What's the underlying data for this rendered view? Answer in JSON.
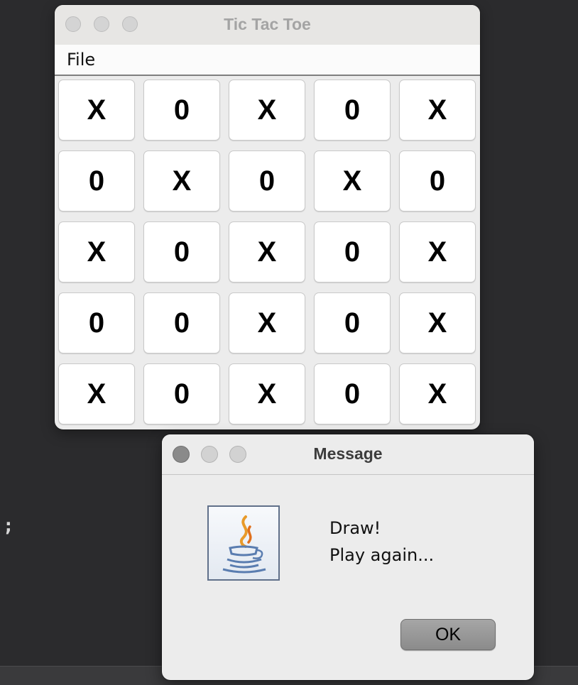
{
  "background": {
    "code_fragment": ";"
  },
  "main_window": {
    "title": "Tic Tac Toe",
    "menu": [
      "File"
    ],
    "board": [
      [
        "X",
        "0",
        "X",
        "0",
        "X"
      ],
      [
        "0",
        "X",
        "0",
        "X",
        "0"
      ],
      [
        "X",
        "0",
        "X",
        "0",
        "X"
      ],
      [
        "0",
        "0",
        "X",
        "0",
        "X"
      ],
      [
        "X",
        "0",
        "X",
        "0",
        "X"
      ]
    ]
  },
  "dialog": {
    "title": "Message",
    "icon": "java-cup-icon",
    "message_lines": [
      "Draw!",
      "Play again..."
    ],
    "ok_label": "OK"
  },
  "colors": {
    "desktop_bg": "#2b2b2d",
    "window_bg": "#ececec",
    "cell_bg": "#ffffff",
    "ok_button_bg": "#9a9a9a"
  }
}
